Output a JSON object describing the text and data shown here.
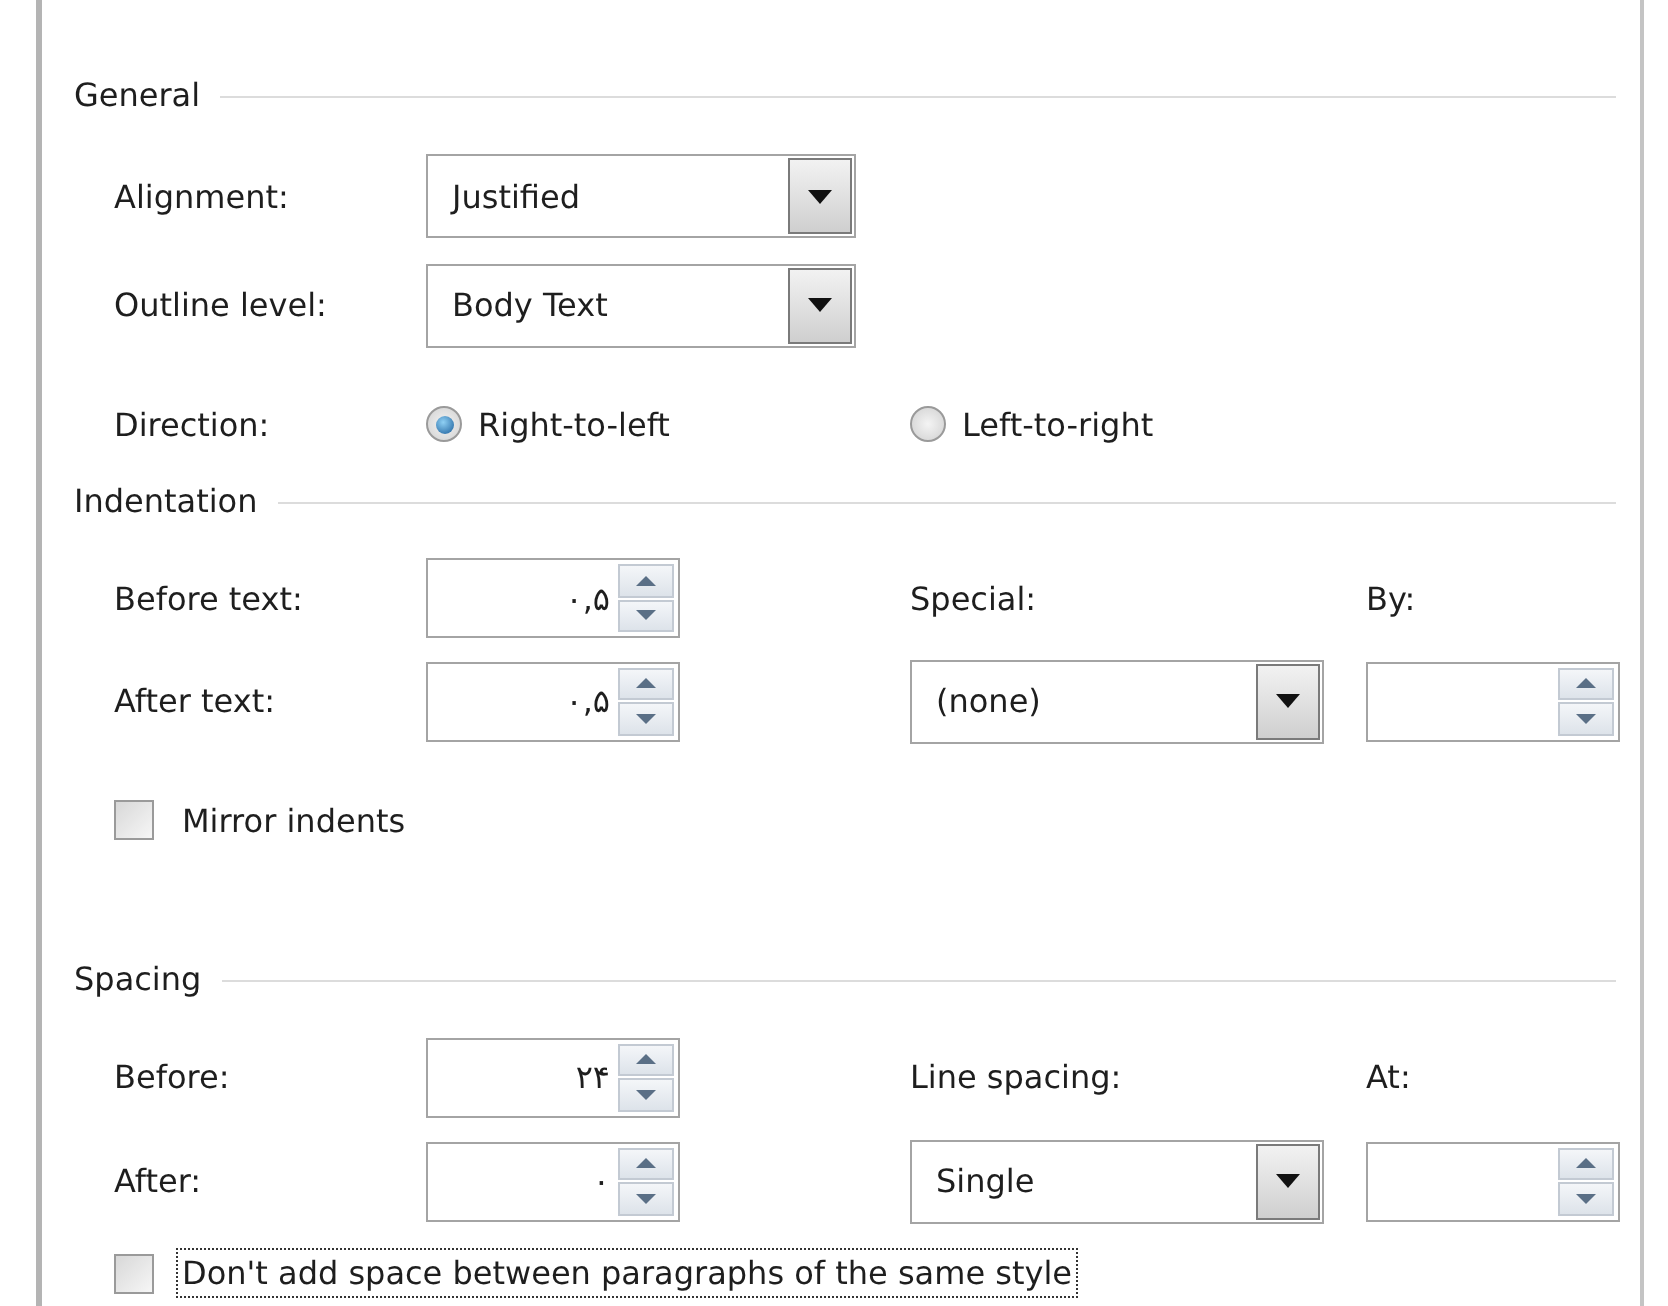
{
  "general": {
    "title": "General",
    "alignment": {
      "label": "Alignment:",
      "value": "Justified"
    },
    "outline_level": {
      "label": "Outline level:",
      "value": "Body Text"
    },
    "direction": {
      "label": "Direction:",
      "options": [
        {
          "label": "Right-to-left",
          "selected": true
        },
        {
          "label": "Left-to-right",
          "selected": false
        }
      ]
    }
  },
  "indentation": {
    "title": "Indentation",
    "before_text": {
      "label": "Before text:",
      "value": "۰,۵"
    },
    "after_text": {
      "label": "After text:",
      "value": "۰,۵"
    },
    "special": {
      "label": "Special:",
      "value": "(none)"
    },
    "by": {
      "label": "By:"
    },
    "mirror_indents": {
      "label": "Mirror indents",
      "checked": false
    }
  },
  "spacing": {
    "title": "Spacing",
    "before": {
      "label": "Before:",
      "value": "۲۴"
    },
    "after": {
      "label": "After:",
      "value": "۰"
    },
    "line_spacing": {
      "label": "Line spacing:",
      "value": "Single"
    },
    "at": {
      "label": "At:"
    },
    "dont_add_space": {
      "label": "Don't add space between paragraphs of the same style",
      "checked": false,
      "focused": true
    }
  }
}
